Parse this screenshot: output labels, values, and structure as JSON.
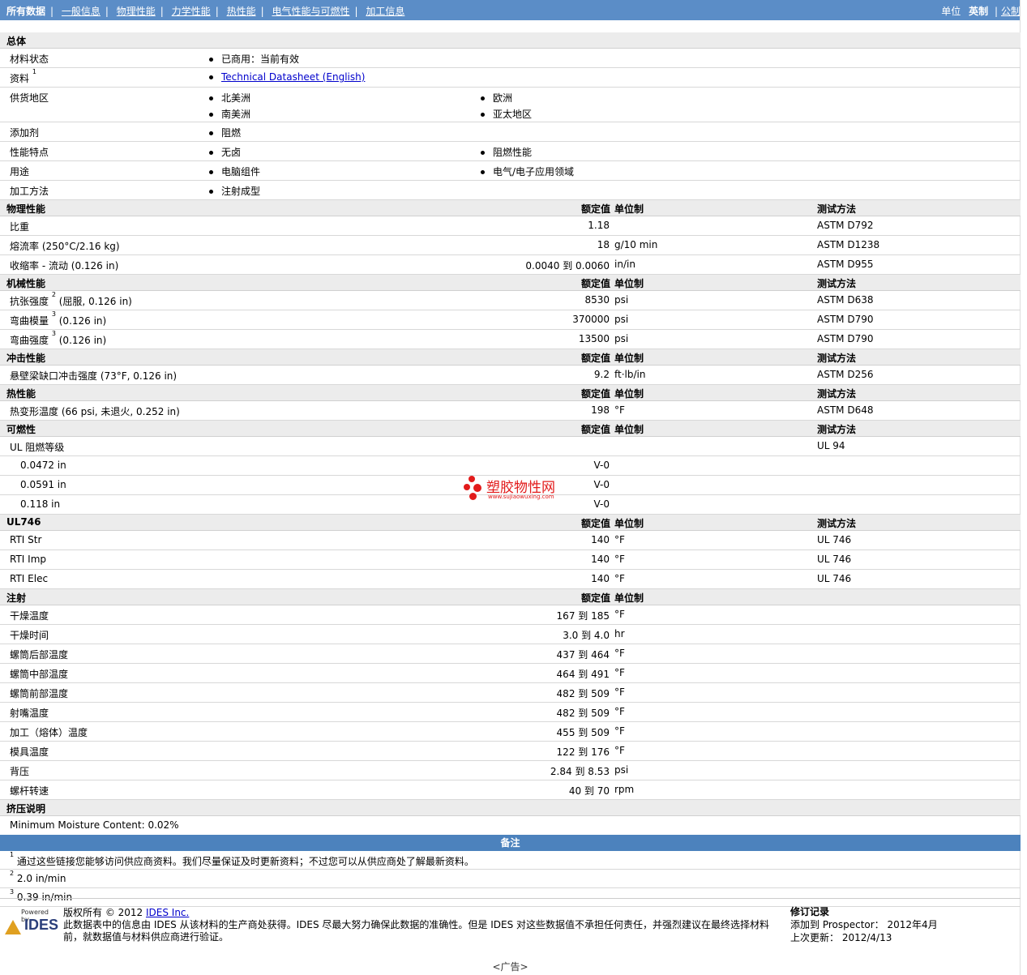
{
  "nav": {
    "items": [
      "所有数据",
      "一般信息",
      "物理性能",
      "力学性能",
      "热性能",
      "电气性能与可燃性",
      "加工信息"
    ],
    "unit_label": "单位",
    "unit_options": [
      "英制",
      "公制"
    ]
  },
  "general": {
    "title": "总体",
    "rows": {
      "status": {
        "label": "材料状态",
        "value": "已商用：当前有效"
      },
      "source": {
        "label": "资料",
        "sup": "1",
        "link": "Technical Datasheet (English)"
      },
      "region": {
        "label": "供货地区",
        "values": [
          "北美洲",
          "欧洲",
          "南美洲",
          "亚太地区"
        ]
      },
      "additive": {
        "label": "添加剂",
        "values": [
          "阻燃"
        ]
      },
      "features": {
        "label": "性能特点",
        "values": [
          "无卤",
          "阻燃性能"
        ]
      },
      "uses": {
        "label": "用途",
        "values": [
          "电脑组件",
          "电气/电子应用领域"
        ]
      },
      "method": {
        "label": "加工方法",
        "values": [
          "注射成型"
        ]
      }
    }
  },
  "col_headers": {
    "value": "额定值",
    "unit": "单位制",
    "test": "测试方法"
  },
  "physical": {
    "title": "物理性能",
    "rows": [
      {
        "label": "比重",
        "value": "1.18",
        "unit": "",
        "test": "ASTM D792"
      },
      {
        "label": "熔流率  (250°C/2.16 kg)",
        "value": "18",
        "unit": "g/10 min",
        "test": "ASTM D1238"
      },
      {
        "label": "收缩率  - 流动  (0.126 in)",
        "value": "0.0040 到  0.0060",
        "unit": "in/in",
        "test": "ASTM D955"
      }
    ]
  },
  "mechanical": {
    "title": "机械性能",
    "rows": [
      {
        "label": "抗张强度",
        "sup": "2",
        "suffix": " (屈服, 0.126 in)",
        "value": "8530",
        "unit": "psi",
        "test": "ASTM D638"
      },
      {
        "label": "弯曲模量",
        "sup": "3",
        "suffix": " (0.126 in)",
        "value": "370000",
        "unit": "psi",
        "test": "ASTM D790"
      },
      {
        "label": "弯曲强度",
        "sup": "3",
        "suffix": " (0.126 in)",
        "value": "13500",
        "unit": "psi",
        "test": "ASTM D790"
      }
    ]
  },
  "impact": {
    "title": "冲击性能",
    "rows": [
      {
        "label": "悬壁梁缺口冲击强度  (73°F, 0.126 in)",
        "value": "9.2",
        "unit": "ft·lb/in",
        "test": "ASTM D256"
      }
    ]
  },
  "thermal": {
    "title": "热性能",
    "rows": [
      {
        "label": "热变形温度  (66 psi, 未退火, 0.252 in)",
        "value": "198",
        "unit": "°F",
        "test": "ASTM D648"
      }
    ]
  },
  "flammability": {
    "title": "可燃性",
    "main": {
      "label": "UL 阻燃等级",
      "test": "UL 94"
    },
    "rows": [
      {
        "label": "0.0472 in",
        "value": "V-0"
      },
      {
        "label": "0.0591 in",
        "value": "V-0"
      },
      {
        "label": "0.118 in",
        "value": "V-0"
      }
    ]
  },
  "ul746": {
    "title": "UL746",
    "rows": [
      {
        "label": "RTI Str",
        "value": "140",
        "unit": "°F",
        "test": "UL 746"
      },
      {
        "label": "RTI Imp",
        "value": "140",
        "unit": "°F",
        "test": "UL 746"
      },
      {
        "label": "RTI Elec",
        "value": "140",
        "unit": "°F",
        "test": "UL 746"
      }
    ]
  },
  "injection": {
    "title": "注射",
    "rows": [
      {
        "label": "干燥温度",
        "value": "167 到  185",
        "unit": "°F"
      },
      {
        "label": "干燥时间",
        "value": "3.0 到  4.0",
        "unit": "hr"
      },
      {
        "label": "螺筒后部温度",
        "value": "437 到  464",
        "unit": "°F"
      },
      {
        "label": "螺筒中部温度",
        "value": "464 到  491",
        "unit": "°F"
      },
      {
        "label": "螺筒前部温度",
        "value": "482 到  509",
        "unit": "°F"
      },
      {
        "label": "射嘴温度",
        "value": "482 到  509",
        "unit": "°F"
      },
      {
        "label": "加工（熔体）温度",
        "value": "455 到  509",
        "unit": "°F"
      },
      {
        "label": "模具温度",
        "value": "122 到  176",
        "unit": "°F"
      },
      {
        "label": "背压",
        "value": "2.84 到  8.53",
        "unit": "psi"
      },
      {
        "label": "螺杆转速",
        "value": "40 到  70",
        "unit": "rpm"
      }
    ]
  },
  "extrusion": {
    "title": "挤压说明",
    "note": "Minimum Moisture Content: 0.02%"
  },
  "notes": {
    "title": "备注",
    "items": [
      {
        "sup": "1",
        "text": "通过这些链接您能够访问供应商资料。我们尽量保证及时更新资料；不过您可以从供应商处了解最新资料。"
      },
      {
        "sup": "2",
        "text": "2.0 in/min"
      },
      {
        "sup": "3",
        "text": "0.39 in/min"
      }
    ]
  },
  "footer": {
    "logo_powered": "Powered by",
    "logo_brand": "IDES",
    "copyright": "版权所有  © 2012 ",
    "company": "IDES Inc.",
    "disclaimer": "此数据表中的信息由  IDES 从该材料的生产商处获得。IDES 尽最大努力确保此数据的准确性。但是  IDES 对这些数据值不承担任何责任，并强烈建议在最终选择材料前，就数据值与材料供应商进行验证。",
    "revision_title": "修订记录",
    "added_label": "添加到  Prospector：",
    "added_value": "2012年4月",
    "updated_label": "上次更新：",
    "updated_value": "2012/4/13"
  },
  "watermark": {
    "main": "塑胶物性网",
    "sub": "www.sujiaowuxing.com"
  },
  "ad": "<广告>"
}
